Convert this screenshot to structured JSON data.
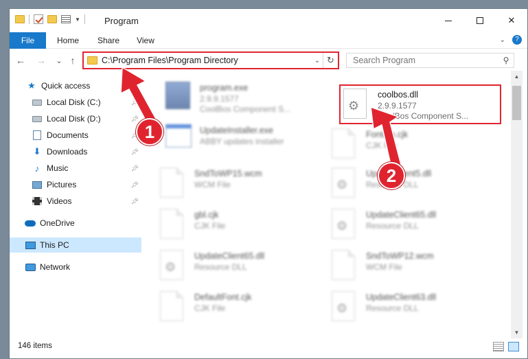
{
  "window": {
    "title": "Program",
    "controls": {
      "minimize": "",
      "maximize": "",
      "close": "✕"
    }
  },
  "ribbon": {
    "tabs": [
      "File",
      "Home",
      "Share",
      "View"
    ]
  },
  "navigation": {
    "back_icon": "←",
    "forward_icon": "→",
    "recent_icon": "⌄",
    "up_icon": "↑",
    "address_path": "C:\\Program Files\\Program Directory",
    "search_placeholder": "Search Program"
  },
  "sidebar": {
    "items": [
      {
        "label": "Quick access",
        "icon": "star-icon",
        "pinned": false
      },
      {
        "label": "Local Disk (C:)",
        "icon": "drive-icon",
        "pinned": true
      },
      {
        "label": "Local Disk (D:)",
        "icon": "drive-icon",
        "pinned": true
      },
      {
        "label": "Documents",
        "icon": "documents-icon",
        "pinned": true
      },
      {
        "label": "Downloads",
        "icon": "downloads-icon",
        "pinned": true
      },
      {
        "label": "Music",
        "icon": "music-icon",
        "pinned": true
      },
      {
        "label": "Pictures",
        "icon": "pictures-icon",
        "pinned": true
      },
      {
        "label": "Videos",
        "icon": "videos-icon",
        "pinned": true
      },
      {
        "label": "OneDrive",
        "icon": "onedrive-icon",
        "pinned": false
      },
      {
        "label": "This PC",
        "icon": "this-pc-icon",
        "pinned": false,
        "selected": true
      },
      {
        "label": "Network",
        "icon": "network-icon",
        "pinned": false
      }
    ]
  },
  "files": {
    "highlighted": {
      "name": "coolbos.dll",
      "version": "2.9.9.1577",
      "description": "CoolBos Component S..."
    },
    "left_column": [
      {
        "name": "program.exe",
        "meta1": "2.9.9.1577",
        "meta2": "CoolBos Component S...",
        "icon": "exe-icon"
      },
      {
        "name": "UpdateInstaller.exe",
        "meta1": "ABBY updates installer",
        "meta2": "",
        "icon": "installer-icon"
      },
      {
        "name": "SndToWP15.wcm",
        "meta1": "WCM File",
        "meta2": "",
        "icon": "doc-icon"
      },
      {
        "name": "gbl.cjk",
        "meta1": "CJK File",
        "meta2": "",
        "icon": "doc-icon"
      },
      {
        "name": "UpdateClient65.dll",
        "meta1": "Resource DLL",
        "meta2": "",
        "icon": "dll-icon"
      },
      {
        "name": "DefaultFont.cjk",
        "meta1": "CJK File",
        "meta2": "",
        "icon": "doc-icon"
      }
    ],
    "right_column": [
      {
        "name": "Fontdm.cjk",
        "meta1": "CJK File",
        "meta2": "",
        "icon": "doc-icon"
      },
      {
        "name": "UpdateClient5.dll",
        "meta1": "Resource DLL",
        "meta2": "",
        "icon": "dll-icon"
      },
      {
        "name": "UpdateClient65.dll",
        "meta1": "Resource DLL",
        "meta2": "",
        "icon": "dll-icon"
      },
      {
        "name": "SndToWP12.wcm",
        "meta1": "WCM File",
        "meta2": "",
        "icon": "doc-icon"
      },
      {
        "name": "UpdateClient63.dll",
        "meta1": "Resource DLL",
        "meta2": "",
        "icon": "dll-icon"
      }
    ]
  },
  "status": {
    "item_count": "146 items"
  },
  "annotations": {
    "badge_1": "1",
    "badge_2": "2",
    "color": "#e0242f"
  }
}
